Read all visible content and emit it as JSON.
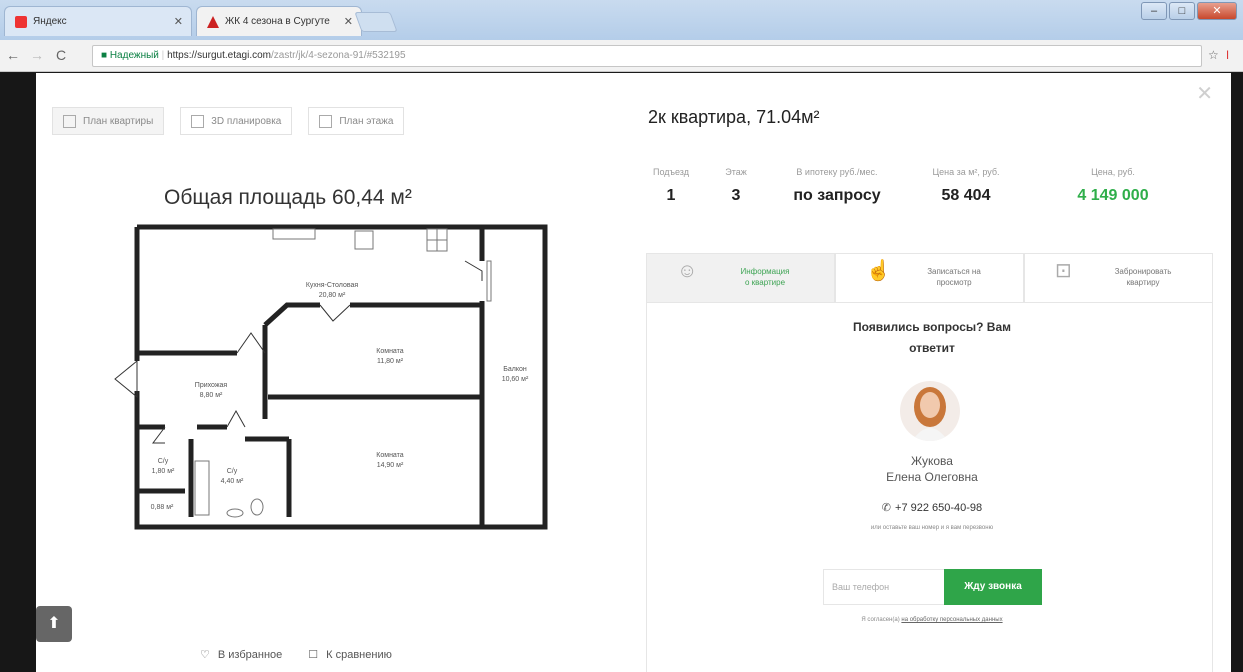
{
  "browser": {
    "tabs": [
      {
        "label": "Яндекс"
      },
      {
        "label": "ЖК 4 сезона в Сургуте"
      }
    ],
    "address": {
      "secure_label": "Надежный",
      "url_host": "https://surgut.etagi.com",
      "url_path": "/zastr/jk/4-sezona-91/#532195"
    }
  },
  "plan": {
    "tabs": [
      {
        "label": "План квартиры"
      },
      {
        "label": "3D планировка"
      },
      {
        "label": "План этажа"
      }
    ],
    "total_area": "Общая площадь 60,44 м²",
    "rooms": [
      {
        "name": "Кухня-Столовая",
        "area": "20,80 м²"
      },
      {
        "name": "Комната",
        "area": "11,80 м²"
      },
      {
        "name": "Балкон",
        "area": "10,60 м²"
      },
      {
        "name": "Прихожая",
        "area": "8,80 м²"
      },
      {
        "name": "Комната",
        "area": "14,90 м²"
      },
      {
        "name": "С/у",
        "area": "1,80 м²"
      },
      {
        "name": "С/у",
        "area": "4,40 м²"
      },
      {
        "name": "",
        "area": "0,88 м²"
      }
    ],
    "actions": {
      "favorite": "В избранное",
      "compare": "К сравнению"
    }
  },
  "apartment": {
    "title": "2к квартира, 71.04м²",
    "stats": [
      {
        "label": "Подъезд",
        "value": "1"
      },
      {
        "label": "Этаж",
        "value": "3"
      },
      {
        "label": "В ипотеку руб./мес.",
        "value": "по запросу"
      },
      {
        "label": "Цена за м², руб.",
        "value": "58 404"
      },
      {
        "label": "Цена, руб.",
        "value": "4 149 000"
      }
    ],
    "colors": {
      "price": "#2fae4a",
      "button": "#2fa549"
    }
  },
  "action_tabs": [
    {
      "label_line1": "Информация",
      "label_line2": "о квартире"
    },
    {
      "label_line1": "Записаться на",
      "label_line2": "просмотр"
    },
    {
      "label_line1": "Забронировать",
      "label_line2": "квартиру"
    }
  ],
  "agent": {
    "question": "Появились вопросы? Вам ответит",
    "surname": "Жукова",
    "first_patronymic": "Елена Олеговна",
    "phone": "+7 922 650-40-98",
    "callback_note": "или оставьте ваш номер и я вам перезвоню",
    "phone_placeholder": "Ваш телефон",
    "call_button": "Жду звонка",
    "consent_prefix": "Я согласен(а)",
    "consent_link": "на обработку персональных данных"
  }
}
